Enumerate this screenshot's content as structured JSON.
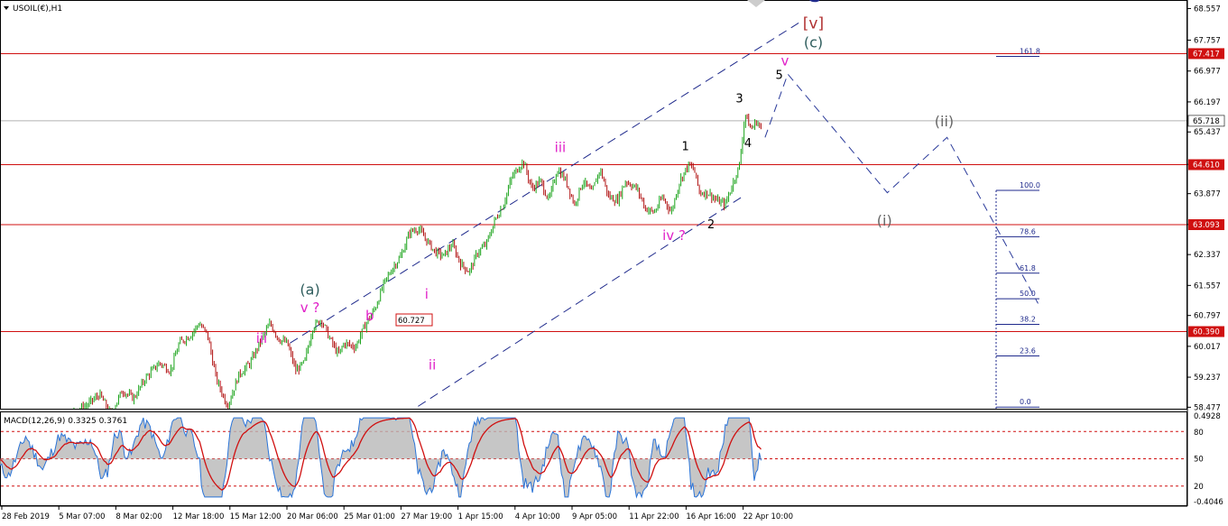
{
  "window": {
    "symbol_label": "USOIL(€),H1",
    "indicator_label": "MACD(12,26,9) 0.3325 0.3761",
    "menu_arrow_icon": "triangle-down-icon"
  },
  "chart_data": {
    "type": "candlestick",
    "title": "USOIL(€),H1",
    "xlabel": "",
    "ylabel": "",
    "ylim": [
      58.44,
      68.75
    ],
    "price_ticks": [
      "68.557",
      "67.757",
      "66.977",
      "66.197",
      "65.437",
      "64.617",
      "63.877",
      "63.097",
      "62.337",
      "61.557",
      "60.797",
      "60.017",
      "59.237",
      "58.477"
    ],
    "time_ticks": [
      "28 Feb 2019",
      "5 Mar 07:00",
      "8 Mar 02:00",
      "12 Mar 18:00",
      "15 Mar 12:00",
      "20 Mar 06:00",
      "25 Mar 01:00",
      "27 Mar 19:00",
      "1 Apr 15:00",
      "4 Apr 10:00",
      "9 Apr 05:00",
      "11 Apr 22:00",
      "16 Apr 16:00",
      "22 Apr 10:00"
    ],
    "current_price": "65.718",
    "current_price_value": 65.718,
    "horizontal_lines": [
      {
        "label": "67.417",
        "value": 67.417
      },
      {
        "label": "64.610",
        "value": 64.61
      },
      {
        "label": "63.093",
        "value": 63.093
      },
      {
        "label": "60.390",
        "value": 60.39
      }
    ],
    "boxed_price_label": "60.727",
    "price_path": [
      [
        0.0,
        58.0
      ],
      [
        0.6,
        57.7
      ],
      [
        1.2,
        58.1
      ],
      [
        1.8,
        57.9
      ],
      [
        2.4,
        58.3
      ],
      [
        3.0,
        58.5
      ],
      [
        3.5,
        58.8
      ],
      [
        3.9,
        58.3
      ],
      [
        4.3,
        58.9
      ],
      [
        4.7,
        58.7
      ],
      [
        5.1,
        59.2
      ],
      [
        5.6,
        59.6
      ],
      [
        6.0,
        59.4
      ],
      [
        6.3,
        60.1
      ],
      [
        6.7,
        60.3
      ],
      [
        7.0,
        60.6
      ],
      [
        7.3,
        60.3
      ],
      [
        7.6,
        59.2
      ],
      [
        8.0,
        58.5
      ],
      [
        8.4,
        59.3
      ],
      [
        8.8,
        59.6
      ],
      [
        9.2,
        60.2
      ],
      [
        9.5,
        60.6
      ],
      [
        9.8,
        60.2
      ],
      [
        10.1,
        60.1
      ],
      [
        10.4,
        59.4
      ],
      [
        10.7,
        59.6
      ],
      [
        11.0,
        60.5
      ],
      [
        11.3,
        60.7
      ],
      [
        11.6,
        60.2
      ],
      [
        11.9,
        59.8
      ],
      [
        12.1,
        60.1
      ],
      [
        12.5,
        60.0
      ],
      [
        12.8,
        60.5
      ],
      [
        13.2,
        61.0
      ],
      [
        13.5,
        61.6
      ],
      [
        13.8,
        62.0
      ],
      [
        14.1,
        62.3
      ],
      [
        14.4,
        62.9
      ],
      [
        14.7,
        63.0
      ],
      [
        15.0,
        62.7
      ],
      [
        15.3,
        62.4
      ],
      [
        15.6,
        62.3
      ],
      [
        15.9,
        62.6
      ],
      [
        16.2,
        62.1
      ],
      [
        16.5,
        61.9
      ],
      [
        16.8,
        62.4
      ],
      [
        17.1,
        62.6
      ],
      [
        17.4,
        63.2
      ],
      [
        17.7,
        63.6
      ],
      [
        18.0,
        64.3
      ],
      [
        18.2,
        64.5
      ],
      [
        18.4,
        64.7
      ],
      [
        18.7,
        64.0
      ],
      [
        19.0,
        64.2
      ],
      [
        19.3,
        63.7
      ],
      [
        19.6,
        64.5
      ],
      [
        19.9,
        64.2
      ],
      [
        20.2,
        63.6
      ],
      [
        20.5,
        64.2
      ],
      [
        20.8,
        63.9
      ],
      [
        21.1,
        64.5
      ],
      [
        21.4,
        63.8
      ],
      [
        21.7,
        63.7
      ],
      [
        22.0,
        64.2
      ],
      [
        22.4,
        64.0
      ],
      [
        22.7,
        63.5
      ],
      [
        23.0,
        63.4
      ],
      [
        23.3,
        63.8
      ],
      [
        23.6,
        63.4
      ],
      [
        23.9,
        64.2
      ],
      [
        24.2,
        64.6
      ],
      [
        24.4,
        64.5
      ],
      [
        24.6,
        63.9
      ],
      [
        24.9,
        63.9
      ],
      [
        25.2,
        63.7
      ],
      [
        25.5,
        63.6
      ],
      [
        25.8,
        64.2
      ],
      [
        26.0,
        64.6
      ],
      [
        26.2,
        65.9
      ],
      [
        26.4,
        65.5
      ],
      [
        26.6,
        65.7
      ],
      [
        26.8,
        65.5
      ]
    ],
    "macd_ticks": [
      "0.4928",
      "80",
      "50",
      "20",
      "-0.4046"
    ],
    "macd_levels": [
      80,
      50,
      20
    ],
    "fib_levels": [
      {
        "label": "161.8",
        "value": 161.8
      },
      {
        "label": "100.0",
        "value": 100.0
      },
      {
        "label": "78.6",
        "value": 78.6
      },
      {
        "label": "61.8",
        "value": 61.8
      },
      {
        "label": "50.0",
        "value": 50.0
      },
      {
        "label": "38.2",
        "value": 38.2
      },
      {
        "label": "23.6",
        "value": 23.6
      },
      {
        "label": "0.0",
        "value": 0.0
      }
    ],
    "projection_path": [
      [
        26.9,
        65.3
      ],
      [
        27.7,
        66.9
      ],
      [
        31.2,
        63.9
      ],
      [
        33.3,
        65.3
      ],
      [
        36.5,
        61.1
      ]
    ],
    "wave_labels": [
      {
        "text": "C",
        "t": 28.6,
        "p": 68.73,
        "color": "#1f2a8c",
        "size": 22,
        "bold": true
      },
      {
        "text": "[v]",
        "t": 28.6,
        "p": 68.06,
        "color": "#b03030",
        "size": 17,
        "bold": false
      },
      {
        "text": "(c)",
        "t": 28.6,
        "p": 67.57,
        "color": "#2f5d5d",
        "size": 16,
        "bold": false
      },
      {
        "text": "v",
        "t": 27.6,
        "p": 67.12,
        "color": "#e020c8",
        "size": 15,
        "bold": false
      },
      {
        "text": "5",
        "t": 27.4,
        "p": 66.78,
        "color": "#000000",
        "size": 13,
        "bold": false
      },
      {
        "text": "3",
        "t": 26.0,
        "p": 66.18,
        "color": "#000000",
        "size": 13,
        "bold": false
      },
      {
        "text": "4",
        "t": 26.3,
        "p": 65.05,
        "color": "#000000",
        "size": 13,
        "bold": false
      },
      {
        "text": "1",
        "t": 24.1,
        "p": 64.98,
        "color": "#000000",
        "size": 13,
        "bold": false
      },
      {
        "text": "2",
        "t": 25.0,
        "p": 63.0,
        "color": "#000000",
        "size": 13,
        "bold": false
      },
      {
        "text": "iii",
        "t": 19.7,
        "p": 64.93,
        "color": "#e020c8",
        "size": 15,
        "bold": false
      },
      {
        "text": "iv ?",
        "t": 23.7,
        "p": 62.7,
        "color": "#e020c8",
        "size": 15,
        "bold": false
      },
      {
        "text": "(i)",
        "t": 31.1,
        "p": 63.07,
        "color": "#666666",
        "size": 16,
        "bold": false
      },
      {
        "text": "(ii)",
        "t": 33.2,
        "p": 65.58,
        "color": "#666666",
        "size": 16,
        "bold": false
      },
      {
        "text": "(a)",
        "t": 10.9,
        "p": 61.33,
        "color": "#2f5d5d",
        "size": 16,
        "bold": false
      },
      {
        "text": "v ?",
        "t": 10.9,
        "p": 60.88,
        "color": "#e020c8",
        "size": 15,
        "bold": false
      },
      {
        "text": "iii",
        "t": 9.2,
        "p": 60.1,
        "color": "#e020c8",
        "size": 15,
        "bold": false
      },
      {
        "text": "b",
        "t": 13.0,
        "p": 60.68,
        "color": "#e020c8",
        "size": 15,
        "bold": false
      },
      {
        "text": "i",
        "t": 15.0,
        "p": 61.22,
        "color": "#e020c8",
        "size": 15,
        "bold": false
      },
      {
        "text": "ii",
        "t": 15.2,
        "p": 59.43,
        "color": "#e020c8",
        "size": 15,
        "bold": false
      }
    ],
    "legend": "none",
    "grid": false
  },
  "colors": {
    "up_candle": "#1aa31a",
    "down_candle": "#b01010",
    "horizontal_line": "#d01010",
    "channel": "#1f2a8c",
    "projection": "#2a3a9a",
    "fib": "#1f2a8c",
    "macd_histogram": "#b8b8b8",
    "macd_line": "#2a74d8",
    "signal_line": "#d01010",
    "current_price_line": "#b0b0b0"
  }
}
